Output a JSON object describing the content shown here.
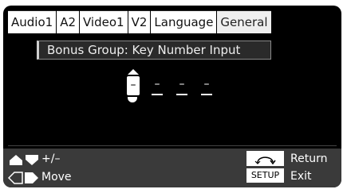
{
  "tabs": [
    {
      "label": "Audio1"
    },
    {
      "label": "A2"
    },
    {
      "label": "Video1"
    },
    {
      "label": "V2"
    },
    {
      "label": "Language"
    },
    {
      "label": "General",
      "active": true
    }
  ],
  "title": "Bonus Group: Key Number Input",
  "digits": [
    "–",
    "–",
    "–",
    "–"
  ],
  "help": {
    "adjust_label": "+/–",
    "move_label": "Move",
    "return_label": "Return",
    "setup_badge": "SETUP",
    "exit_label": "Exit"
  },
  "icons": {
    "adjust": "up-down-arrows-icon",
    "move": "left-right-arrows-icon",
    "return": "return-arrow-icon"
  },
  "colors": {
    "background": "#000000",
    "footer": "#3a3a3a",
    "text": "#ffffff"
  }
}
